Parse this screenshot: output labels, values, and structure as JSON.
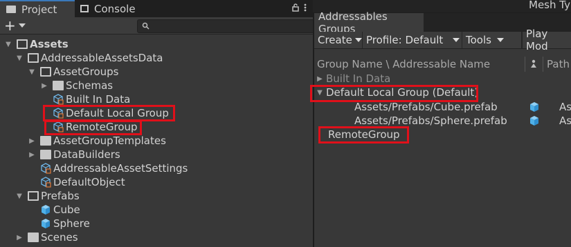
{
  "project_panel": {
    "tabs": [
      {
        "label": "Project",
        "icon": "folder-icon"
      },
      {
        "label": "Console",
        "icon": "console-icon"
      }
    ],
    "add_button": "+",
    "tree": [
      {
        "label": "Assets",
        "bold": true,
        "icon": "folder-open-icon"
      },
      {
        "label": "AddressableAssetsData",
        "icon": "folder-open-icon"
      },
      {
        "label": "AssetGroups",
        "icon": "folder-open-icon"
      },
      {
        "label": "Schemas",
        "icon": "folder-icon"
      },
      {
        "label": "Built In Data",
        "icon": "addressable-group-icon"
      },
      {
        "label": "Default Local Group",
        "icon": "addressable-group-icon"
      },
      {
        "label": "RemoteGroup",
        "icon": "addressable-group-icon"
      },
      {
        "label": "AssetGroupTemplates",
        "icon": "folder-icon"
      },
      {
        "label": "DataBuilders",
        "icon": "folder-icon"
      },
      {
        "label": "AddressableAssetSettings",
        "icon": "addressable-settings-icon"
      },
      {
        "label": "DefaultObject",
        "icon": "addressable-settings-icon"
      },
      {
        "label": "Prefabs",
        "icon": "folder-open-icon"
      },
      {
        "label": "Cube",
        "icon": "prefab-cube-icon"
      },
      {
        "label": "Sphere",
        "icon": "prefab-cube-icon"
      },
      {
        "label": "Scenes",
        "icon": "folder-icon"
      }
    ]
  },
  "top_right": {
    "label": "Mesh Ty"
  },
  "addressables": {
    "window_title": "Addressables Groups",
    "menus": [
      {
        "label": "Create"
      },
      {
        "label": "Profile: Default"
      },
      {
        "label": "Tools"
      },
      {
        "label": "Play Mod"
      }
    ],
    "header": {
      "name_col": "Group Name \\ Addressable Name",
      "path_col": "Path"
    },
    "rows": [
      {
        "label": "Built In Data"
      },
      {
        "label": "Default Local Group (Default)"
      },
      {
        "label": "Assets/Prefabs/Cube.prefab",
        "path": "Ass"
      },
      {
        "label": "Assets/Prefabs/Sphere.prefab",
        "path": "As"
      },
      {
        "label": "RemoteGroup"
      }
    ]
  },
  "colors": {
    "highlight": "#e0101a",
    "accent": "#3a79bb",
    "cube": "#4fb0e8"
  }
}
